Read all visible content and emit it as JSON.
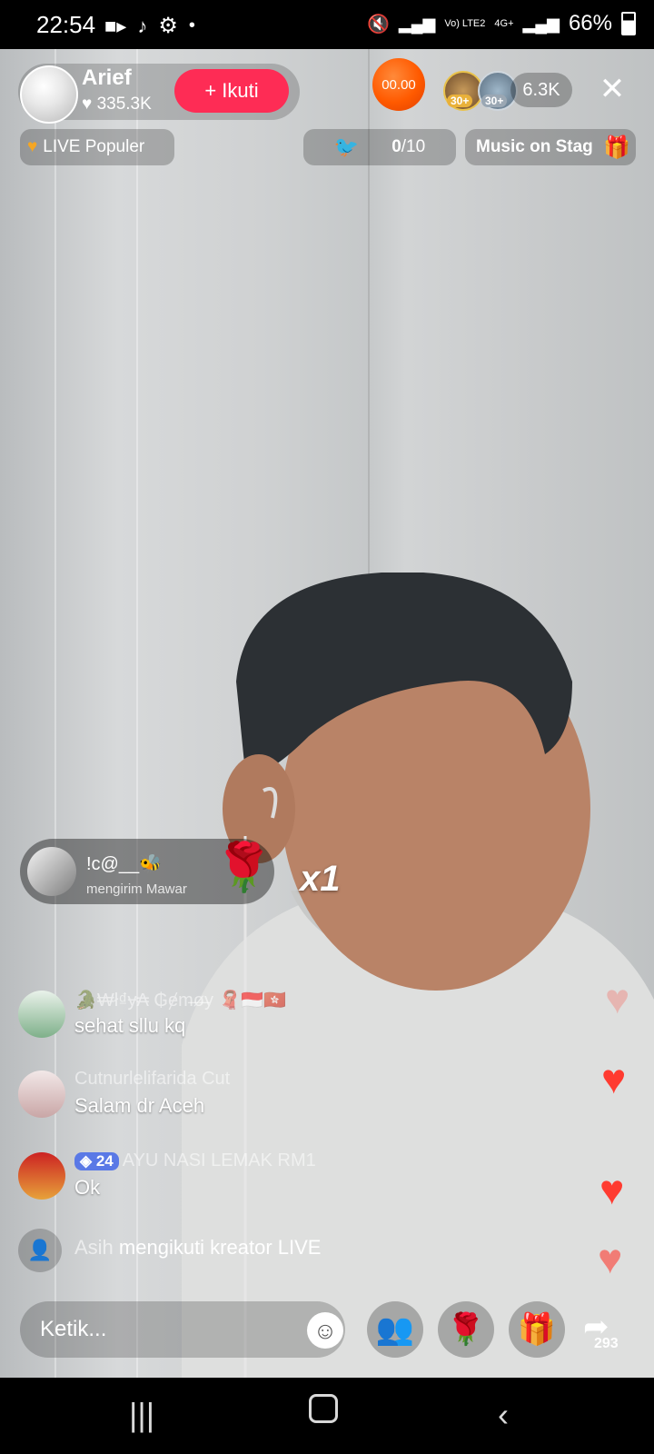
{
  "status_bar": {
    "time": "22:54",
    "battery": "66%",
    "network_labels": [
      "Vo) LTE2",
      "4G+"
    ],
    "icons": [
      "video-camera-icon",
      "tiktok-icon",
      "settings-gear-icon",
      "dot-icon",
      "mute-icon",
      "signal-icon",
      "battery-icon"
    ]
  },
  "host": {
    "name": "Arief",
    "likes": "335.3K",
    "follow_label": "+ Ikuti"
  },
  "top_right": {
    "coin_value": "00.00",
    "viewer_badges": [
      "30+",
      "30+"
    ],
    "viewer_count": "6.3K",
    "close_icon": "close-icon"
  },
  "chips": {
    "live_popular": "LIVE Populer",
    "goal_count": "0",
    "goal_total": "/10",
    "music": "Music on Stag"
  },
  "gift": {
    "user": "!c@__🐝",
    "subtitle": "mengirim Mawar",
    "count": "x1",
    "gift_icon": "rose-icon"
  },
  "comments": [
    {
      "user": "🐊₩ł₫ɏ₳ ₲ɇm̶ø̶y 🧣🇮🇩🇭🇰",
      "text": "sehat sllu kq",
      "level": ""
    },
    {
      "user": "Cutnurlelifarida Cut",
      "text": "Salam dr Aceh",
      "level": ""
    },
    {
      "user": "AYU NASI LEMAK RM1",
      "text": "Ok",
      "level": "24"
    }
  ],
  "follow_note": {
    "name": "Asih",
    "text": " mengikuti kreator LIVE"
  },
  "bottom_bar": {
    "input_placeholder": "Ketik...",
    "share_count": "293"
  },
  "colors": {
    "follow_button": "#fe2c55",
    "coin": "#ff5a00",
    "heart": "#ff3b30",
    "level_badge": "#5a79e6"
  }
}
